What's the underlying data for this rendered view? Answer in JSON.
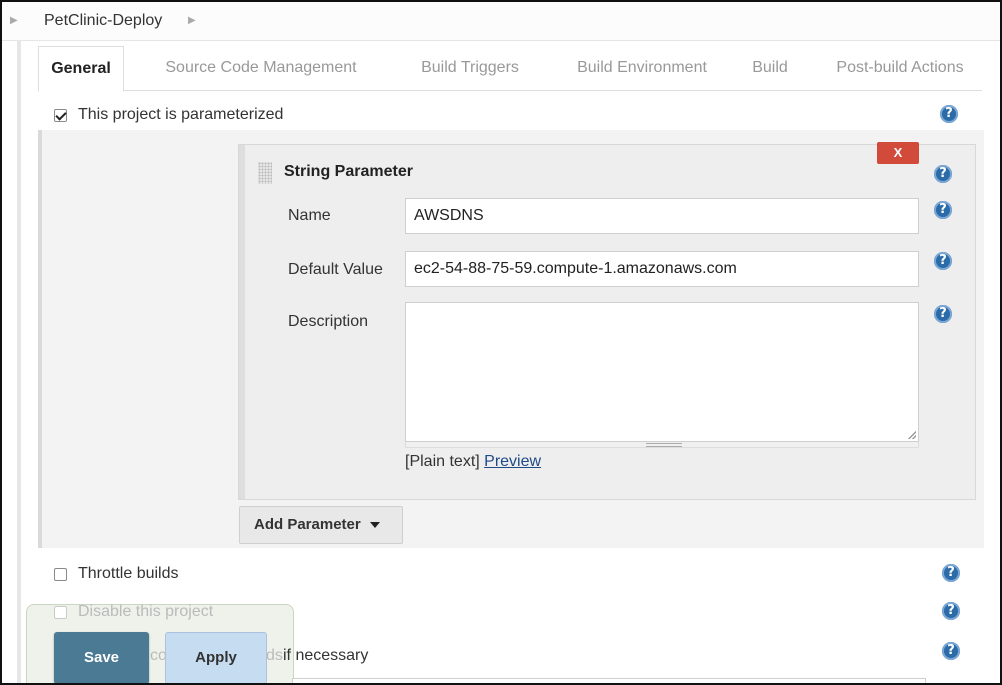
{
  "breadcrumb": {
    "project": "PetClinic-Deploy"
  },
  "tabs": [
    {
      "label": "General"
    },
    {
      "label": "Source Code Management"
    },
    {
      "label": "Build Triggers"
    },
    {
      "label": "Build Environment"
    },
    {
      "label": "Build"
    },
    {
      "label": "Post-build Actions"
    }
  ],
  "help_icon": "?",
  "parameterized": {
    "label": "This project is parameterized",
    "checked": true
  },
  "string_param": {
    "title": "String Parameter",
    "delete_label": "X",
    "name_label": "Name",
    "name_value": "AWSDNS",
    "default_label": "Default Value",
    "default_value": "ec2-54-88-75-59.compute-1.amazonaws.com",
    "description_label": "Description",
    "description_value": "",
    "plain_text": "[Plain text]",
    "preview": "Preview"
  },
  "add_parameter": {
    "label": "Add Parameter"
  },
  "options": {
    "throttle": {
      "label": "Throttle builds",
      "checked": false
    },
    "disable": {
      "label": "Disable this project",
      "checked": false
    },
    "concurrent_visible_a": "co",
    "concurrent_visible_b": "ds",
    "concurrent_visible_c": "if necessary"
  },
  "actions": {
    "save": "Save",
    "apply": "Apply"
  }
}
